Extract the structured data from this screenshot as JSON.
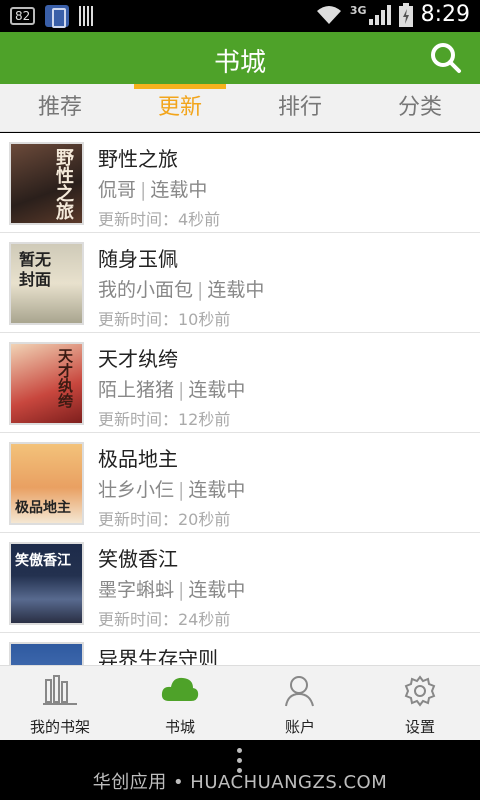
{
  "status_bar": {
    "battery_level": "82",
    "network": "3G",
    "time": "8:29"
  },
  "header": {
    "title": "书城"
  },
  "tabs": [
    {
      "label": "推荐",
      "active": false
    },
    {
      "label": "更新",
      "active": true
    },
    {
      "label": "排行",
      "active": false
    },
    {
      "label": "分类",
      "active": false
    }
  ],
  "books": [
    {
      "title": "野性之旅",
      "author": "侃哥",
      "status": "连载中",
      "updated": "更新时间：4秒前",
      "cover_text": "野性之旅",
      "cover_color": "#3b2d27"
    },
    {
      "title": "随身玉佩",
      "author": "我的小面包",
      "status": "连载中",
      "updated": "更新时间：10秒前",
      "cover_text": "暂无封面",
      "cover_color": "#d9d2bf"
    },
    {
      "title": "天才纨绔",
      "author": "陌上猪猪",
      "status": "连载中",
      "updated": "更新时间：12秒前",
      "cover_text": "天才纨绔",
      "cover_color": "#c8473e"
    },
    {
      "title": "极品地主",
      "author": "壮乡小仨",
      "status": "连载中",
      "updated": "更新时间：20秒前",
      "cover_text": "极品地主",
      "cover_color": "#e9a062"
    },
    {
      "title": "笑傲香江",
      "author": "墨字蝌蚪",
      "status": "连载中",
      "updated": "更新时间：24秒前",
      "cover_text": "笑傲香江",
      "cover_color": "#23314f"
    },
    {
      "title": "异界生存守则",
      "author": "",
      "status": "",
      "updated": "",
      "cover_text": "",
      "cover_color": "#2f5aa0"
    }
  ],
  "bottom_nav": [
    {
      "label": "我的书架",
      "icon": "bookshelf-icon",
      "active": false
    },
    {
      "label": "书城",
      "icon": "cloud-icon",
      "active": true
    },
    {
      "label": "账户",
      "icon": "user-icon",
      "active": false
    },
    {
      "label": "设置",
      "icon": "gear-icon",
      "active": false
    }
  ],
  "footer": {
    "watermark": "华创应用 • HUACHUANGZS.COM"
  },
  "colors": {
    "accent_green": "#4ea229",
    "tab_active": "#f2a51c"
  }
}
